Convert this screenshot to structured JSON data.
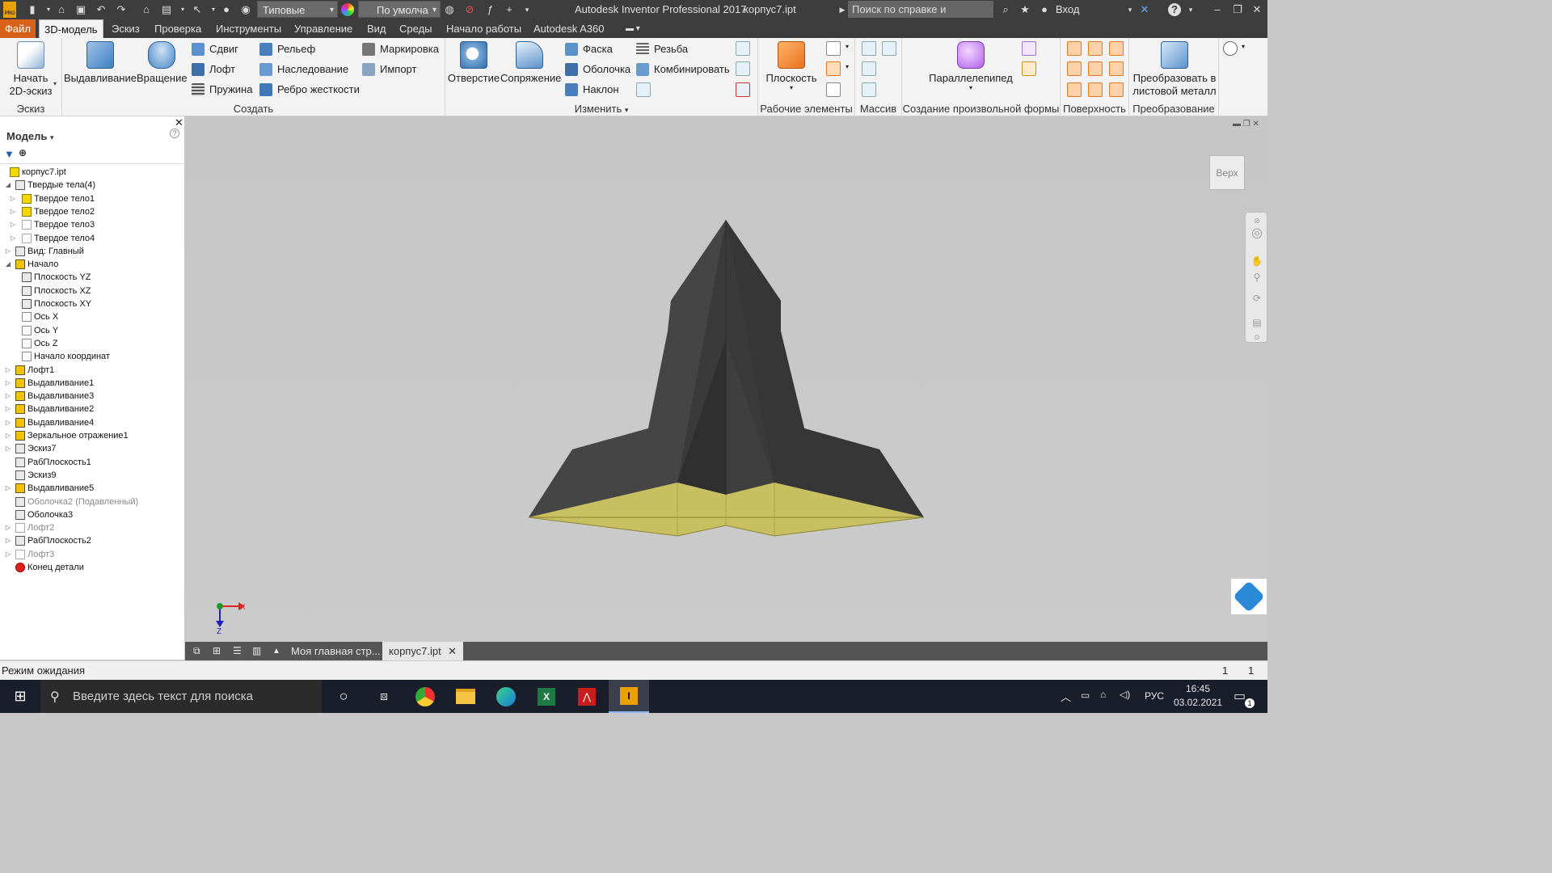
{
  "titlebar": {
    "app_title": "Autodesk Inventor Professional 2017",
    "document": "корпус7.ipt",
    "material_combo": "Типовые",
    "appearance_combo": "По умолча",
    "help_search_placeholder": "Поиск по справке и командам",
    "signin": "Вход",
    "pro_badge": "PRO"
  },
  "ribbon_tabs": [
    "Файл",
    "3D-модель",
    "Эскиз",
    "Проверка",
    "Инструменты",
    "Управление",
    "Вид",
    "Среды",
    "Начало работы",
    "Autodesk A360"
  ],
  "active_tab": "3D-модель",
  "ribbon": {
    "sketch": {
      "label": "Эскиз",
      "start_line1": "Начать",
      "start_line2": "2D-эскиз"
    },
    "create": {
      "label": "Создать",
      "extrude": "Выдавливание",
      "revolve": "Вращение",
      "sweep": "Сдвиг",
      "loft": "Лофт",
      "coil": "Пружина",
      "emboss": "Рельеф",
      "derive": "Наследование",
      "rib": "Ребро жесткости",
      "mark": "Маркировка",
      "import": "Импорт"
    },
    "modify": {
      "label": "Изменить",
      "hole": "Отверстие",
      "fillet": "Сопряжение",
      "chamfer": "Фаска",
      "shell": "Оболочка",
      "draft": "Наклон",
      "thread": "Резьба",
      "combine": "Комбинировать"
    },
    "work": {
      "label": "Рабочие элементы",
      "plane": "Плоскость"
    },
    "pattern": {
      "label": "Массив"
    },
    "freeform": {
      "label": "Создание произвольной формы",
      "box": "Параллелепипед"
    },
    "surface": {
      "label": "Поверхность"
    },
    "convert": {
      "label": "Преобразование",
      "sheet_line1": "Преобразовать в",
      "sheet_line2": "листовой металл"
    }
  },
  "model_panel": {
    "title": "Модель",
    "tree": [
      {
        "label": "корпус7.ipt",
        "indent": 0,
        "exp": "",
        "icon": "part"
      },
      {
        "label": "Твердые тела(4)",
        "indent": 1,
        "exp": "◢",
        "icon": "bodies"
      },
      {
        "label": "Твердое тело1",
        "indent": 2,
        "exp": "▷",
        "icon": "y"
      },
      {
        "label": "Твердое тело2",
        "indent": 2,
        "exp": "▷",
        "icon": "y"
      },
      {
        "label": "Твердое тело3",
        "indent": 2,
        "exp": "▷",
        "icon": "w"
      },
      {
        "label": "Твердое тело4",
        "indent": 2,
        "exp": "▷",
        "icon": "w"
      },
      {
        "label": "Вид: Главный",
        "indent": 1,
        "exp": "▷",
        "icon": "view"
      },
      {
        "label": "Начало",
        "indent": 1,
        "exp": "◢",
        "icon": "folder"
      },
      {
        "label": "Плоскость YZ",
        "indent": 2,
        "exp": "",
        "icon": "pl"
      },
      {
        "label": "Плоскость XZ",
        "indent": 2,
        "exp": "",
        "icon": "pl"
      },
      {
        "label": "Плоскость XY",
        "indent": 2,
        "exp": "",
        "icon": "pl"
      },
      {
        "label": "Ось X",
        "indent": 2,
        "exp": "",
        "icon": "ax"
      },
      {
        "label": "Ось Y",
        "indent": 2,
        "exp": "",
        "icon": "ax"
      },
      {
        "label": "Ось Z",
        "indent": 2,
        "exp": "",
        "icon": "ax"
      },
      {
        "label": "Начало координат",
        "indent": 2,
        "exp": "",
        "icon": "pt"
      },
      {
        "label": "Лофт1",
        "indent": 1,
        "exp": "▷",
        "icon": "ex"
      },
      {
        "label": "Выдавливание1",
        "indent": 1,
        "exp": "▷",
        "icon": "ex"
      },
      {
        "label": "Выдавливание3",
        "indent": 1,
        "exp": "▷",
        "icon": "ex"
      },
      {
        "label": "Выдавливание2",
        "indent": 1,
        "exp": "▷",
        "icon": "ex"
      },
      {
        "label": "Выдавливание4",
        "indent": 1,
        "exp": "▷",
        "icon": "ex"
      },
      {
        "label": "Зеркальное отражение1",
        "indent": 1,
        "exp": "▷",
        "icon": "ex"
      },
      {
        "label": "Эскиз7",
        "indent": 1,
        "exp": "▷",
        "icon": "pl"
      },
      {
        "label": "РабПлоскость1",
        "indent": 1,
        "exp": "",
        "icon": "pl"
      },
      {
        "label": "Эскиз9",
        "indent": 1,
        "exp": "",
        "icon": "pl"
      },
      {
        "label": "Выдавливание5",
        "indent": 1,
        "exp": "▷",
        "icon": "ex"
      },
      {
        "label": "Оболочка2 (Подавленный)",
        "indent": 1,
        "exp": "",
        "icon": "pl",
        "style": "strike"
      },
      {
        "label": "Оболочка3",
        "indent": 1,
        "exp": "",
        "icon": "pl"
      },
      {
        "label": "Лофт2",
        "indent": 1,
        "exp": "▷",
        "icon": "w",
        "style": "grey"
      },
      {
        "label": "РабПлоскость2",
        "indent": 1,
        "exp": "▷",
        "icon": "pl"
      },
      {
        "label": "Лофт3",
        "indent": 1,
        "exp": "▷",
        "icon": "w",
        "style": "grey"
      },
      {
        "label": "Конец детали",
        "indent": 1,
        "exp": "",
        "icon": "red"
      }
    ]
  },
  "viewcube": {
    "face": "Верх"
  },
  "triad": {
    "x": "X",
    "z": "Z"
  },
  "doc_tabs": {
    "home": "Моя главная стр...",
    "part": "корпус7.ipt"
  },
  "status": {
    "text": "Режим ожидания",
    "count1": "1",
    "count2": "1"
  },
  "taskbar": {
    "search_placeholder": "Введите здесь текст для поиска",
    "lang": "РУС",
    "time": "16:45",
    "date": "03.02.2021",
    "notif_count": "1"
  }
}
